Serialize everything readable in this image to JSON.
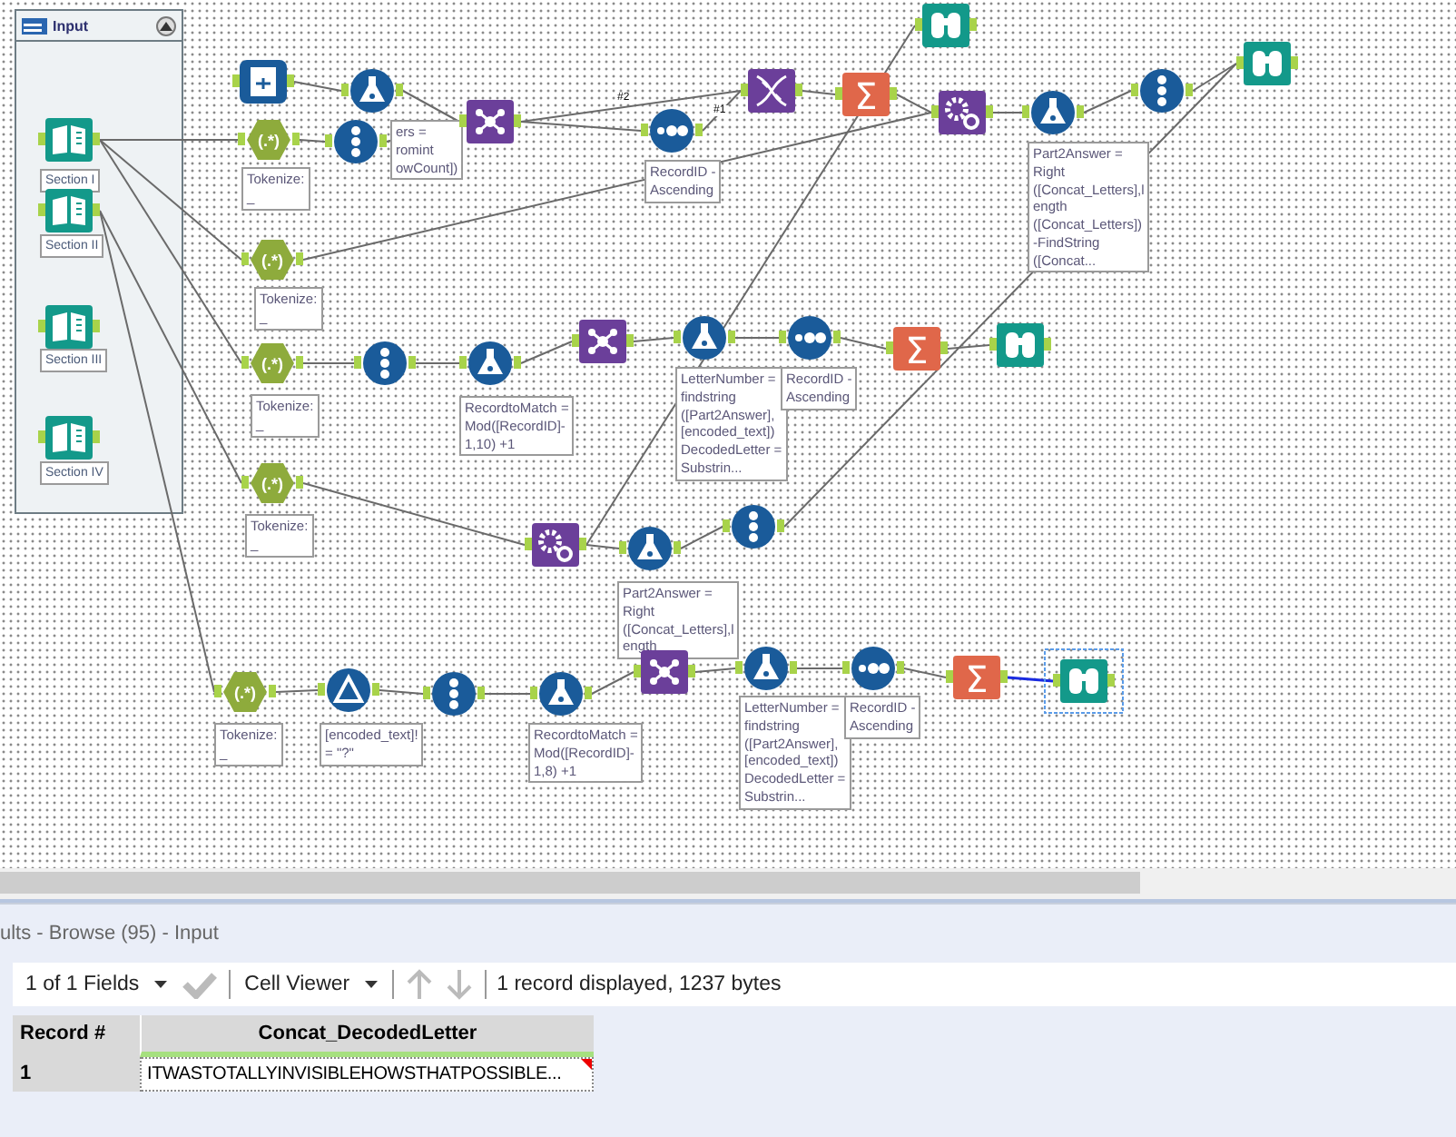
{
  "canvas": {
    "container": {
      "title": "Input",
      "expanded": true
    },
    "connection_labels": [
      "#2",
      "#1"
    ],
    "nodes": [
      {
        "kind": "book",
        "selected": false,
        "annotation": "Section I"
      },
      {
        "kind": "book",
        "selected": false,
        "annotation": "Section II"
      },
      {
        "kind": "book",
        "selected": false,
        "annotation": "Section III"
      },
      {
        "kind": "book",
        "selected": false,
        "annotation": "Section IV"
      },
      {
        "kind": "input",
        "selected": false
      },
      {
        "kind": "tokenize",
        "selected": false,
        "glyph": "(.*)",
        "annotation": "Tokenize:\n_"
      },
      {
        "kind": "recordid",
        "selected": false
      },
      {
        "kind": "formula",
        "selected": false,
        "annotation": "ers =\nromint\nowCount])"
      },
      {
        "kind": "join",
        "selected": false
      },
      {
        "kind": "makecolumns",
        "selected": false
      },
      {
        "kind": "sort",
        "selected": false,
        "annotation": "RecordID -\nAscending"
      },
      {
        "kind": "summarize",
        "selected": false,
        "glyph": "Σ"
      },
      {
        "kind": "append",
        "selected": false
      },
      {
        "kind": "formula",
        "selected": false,
        "annotation": "Part2Answer =\nRight\n([Concat_Letters],l\nength\n([Concat_Letters])\n-FindString\n([Concat..."
      },
      {
        "kind": "recordid",
        "selected": false
      },
      {
        "kind": "browse",
        "selected": false
      },
      {
        "kind": "browse",
        "selected": false
      },
      {
        "kind": "tokenize",
        "selected": false,
        "glyph": "(.*)",
        "annotation": "Tokenize:\n_"
      },
      {
        "kind": "tokenize",
        "selected": false,
        "glyph": "(.*)",
        "annotation": "Tokenize:\n_"
      },
      {
        "kind": "recordid",
        "selected": false
      },
      {
        "kind": "formula",
        "selected": false,
        "annotation": "RecordtoMatch =\nMod([RecordID]-\n1,10) +1"
      },
      {
        "kind": "join",
        "selected": false
      },
      {
        "kind": "formula",
        "selected": false,
        "annotation": "LetterNumber =\nfindstring\n([Part2Answer],\n[encoded_text])\nDecodedLetter =\nSubstrin..."
      },
      {
        "kind": "sort",
        "selected": false,
        "annotation": "RecordID -\nAscending"
      },
      {
        "kind": "summarize",
        "selected": false,
        "glyph": "Σ"
      },
      {
        "kind": "browse",
        "selected": false
      },
      {
        "kind": "tokenize",
        "selected": false,
        "glyph": "(.*)",
        "annotation": "Tokenize:\n_"
      },
      {
        "kind": "append",
        "selected": false
      },
      {
        "kind": "formula",
        "selected": false,
        "annotation": "Part2Answer =\nRight\n([Concat_Letters],l\nength"
      },
      {
        "kind": "recordid",
        "selected": false
      },
      {
        "kind": "tokenize",
        "selected": false,
        "glyph": "(.*)",
        "annotation": "Tokenize:\n_"
      },
      {
        "kind": "filter",
        "selected": false,
        "annotation": "[encoded_text]!\n= \"?\""
      },
      {
        "kind": "recordid",
        "selected": false
      },
      {
        "kind": "formula",
        "selected": false,
        "annotation": "RecordtoMatch =\nMod([RecordID]-\n1,8) +1"
      },
      {
        "kind": "join",
        "selected": false
      },
      {
        "kind": "formula",
        "selected": false,
        "annotation": "LetterNumber =\nfindstring\n([Part2Answer],\n[encoded_text])\nDecodedLetter =\nSubstrin..."
      },
      {
        "kind": "sort",
        "selected": false,
        "annotation": "RecordID -\nAscending"
      },
      {
        "kind": "summarize",
        "selected": false,
        "glyph": "Σ"
      },
      {
        "kind": "browse",
        "selected": true
      }
    ]
  },
  "results": {
    "title": "ults - Browse (95) - Input",
    "toolbar": {
      "fields": "1 of 1 Fields",
      "viewer": "Cell Viewer",
      "status": "1 record displayed, 1237 bytes"
    },
    "table": {
      "columns": [
        "Record #",
        "Concat_DecodedLetter"
      ],
      "rows": [
        {
          "cells": [
            "1",
            "ITWASTOTALLYINVISIBLEHOWSTHATPOSSIBLE..."
          ]
        }
      ]
    }
  }
}
